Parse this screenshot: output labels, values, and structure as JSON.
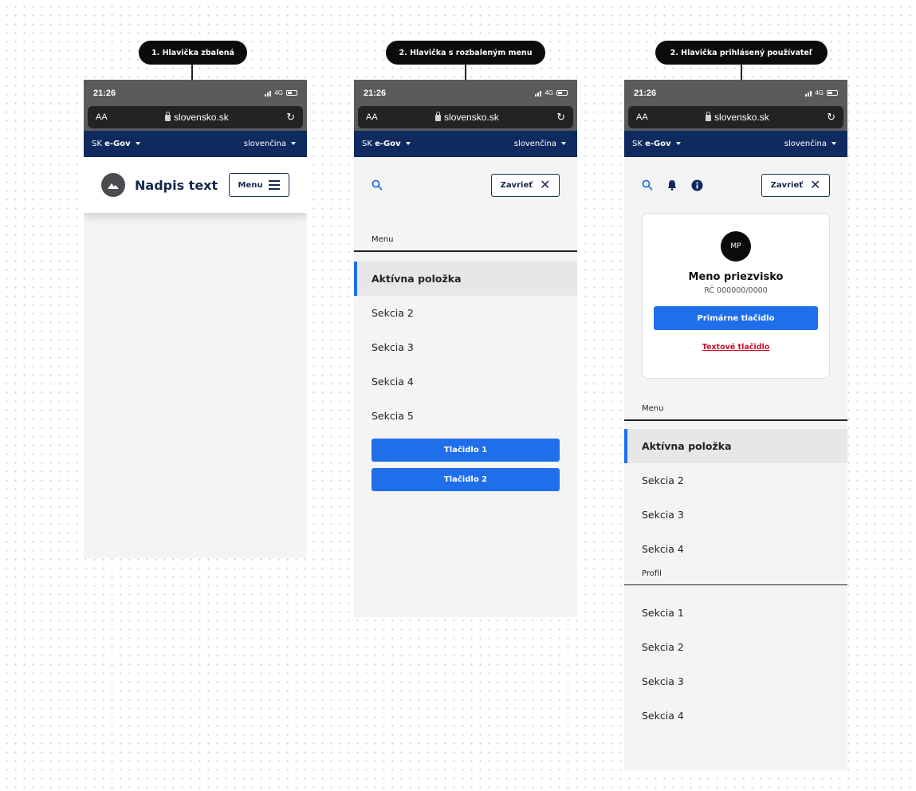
{
  "screens": [
    {
      "tag": "1. Hlavička zbalená",
      "status": {
        "time": "21:26",
        "network": "4G"
      },
      "browser": {
        "aa": "AA",
        "url": "slovensko.sk"
      },
      "egov": {
        "prefix": "SK",
        "brand": "e-Gov",
        "language": "slovenčina"
      },
      "header": {
        "title": "Nadpis text",
        "menu_label": "Menu"
      }
    },
    {
      "tag": "2. Hlavička s rozbaleným menu",
      "status": {
        "time": "21:26",
        "network": "4G"
      },
      "browser": {
        "aa": "AA",
        "url": "slovensko.sk"
      },
      "egov": {
        "prefix": "SK",
        "brand": "e-Gov",
        "language": "slovenčina"
      },
      "header": {
        "close_label": "Zavrieť"
      },
      "menu": {
        "label": "Menu",
        "items": [
          "Aktívna položka",
          "Sekcia 2",
          "Sekcia 3",
          "Sekcia 4",
          "Sekcia 5"
        ],
        "active_index": 0
      },
      "buttons": [
        "Tlačidlo 1",
        "Tlačidlo 2"
      ]
    },
    {
      "tag": "2. Hlavička prihlásený používateľ",
      "status": {
        "time": "21:26",
        "network": "4G"
      },
      "browser": {
        "aa": "AA",
        "url": "slovensko.sk"
      },
      "egov": {
        "prefix": "SK",
        "brand": "e-Gov",
        "language": "slovenčina"
      },
      "header": {
        "close_label": "Zavrieť"
      },
      "user": {
        "initials": "MP",
        "name": "Meno priezvisko",
        "id": "RČ 000000/0000",
        "primary_button": "Primárne tlačidlo",
        "text_button": "Textové tlačidlo"
      },
      "menu": {
        "label": "Menu",
        "items": [
          "Aktívna položka",
          "Sekcia 2",
          "Sekcia 3",
          "Sekcia 4"
        ],
        "active_index": 0
      },
      "profile": {
        "label": "Profil",
        "items": [
          "Sekcia 1",
          "Sekcia 2",
          "Sekcia 3",
          "Sekcia 4"
        ]
      }
    }
  ],
  "colors": {
    "egov_bar": "#0f2a5e",
    "primary": "#1f6feb",
    "text_button": "#c8102e",
    "status_bar": "#5a5b5d"
  }
}
